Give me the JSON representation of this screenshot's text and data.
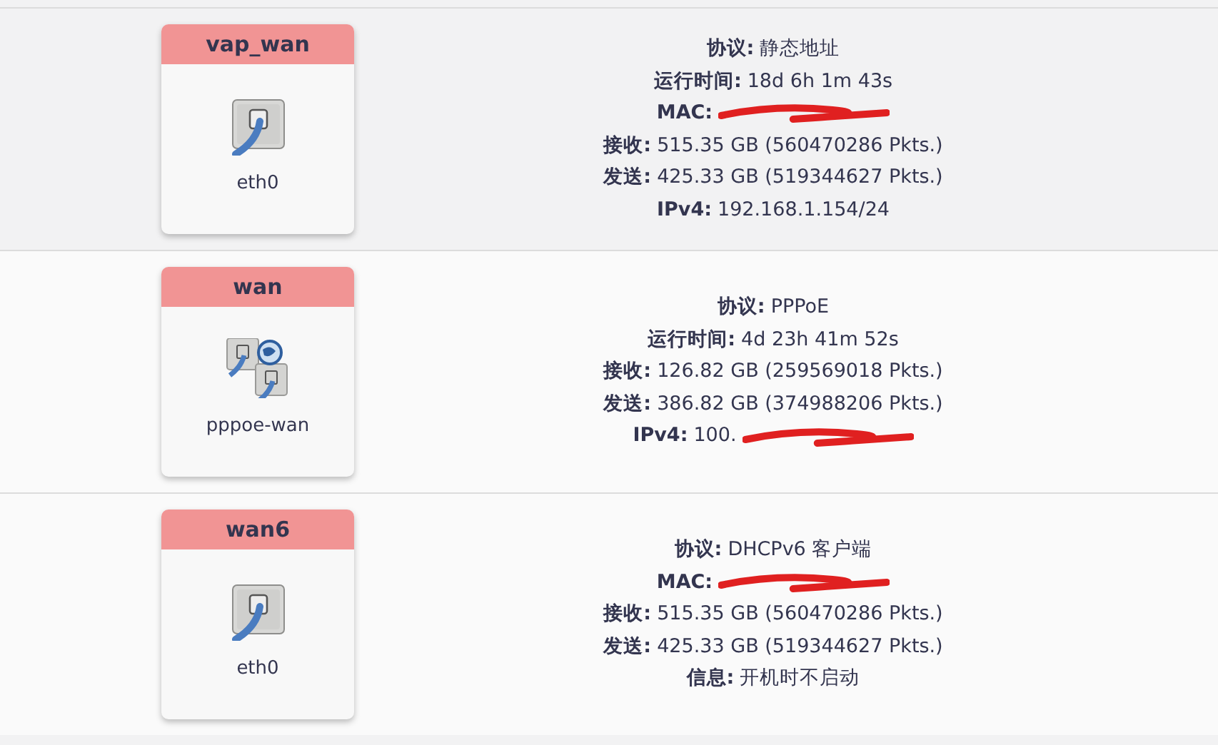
{
  "interfaces": [
    {
      "name": "vap_wan",
      "kind": "ethernet",
      "device": "eth0",
      "details": [
        {
          "label": "协议:",
          "value": "静态地址"
        },
        {
          "label": "运行时间:",
          "value": "18d 6h 1m 43s"
        },
        {
          "label": "MAC:",
          "redacted": true
        },
        {
          "label": "接收:",
          "value": "515.35 GB (560470286 Pkts.)"
        },
        {
          "label": "发送:",
          "value": "425.33 GB (519344627 Pkts.)"
        },
        {
          "label": "IPv4:",
          "value": "192.168.1.154/24"
        }
      ]
    },
    {
      "name": "wan",
      "kind": "pppoe",
      "device": "pppoe-wan",
      "details": [
        {
          "label": "协议:",
          "value": "PPPoE"
        },
        {
          "label": "运行时间:",
          "value": "4d 23h 41m 52s"
        },
        {
          "label": "接收:",
          "value": "126.82 GB (259569018 Pkts.)"
        },
        {
          "label": "发送:",
          "value": "386.82 GB (374988206 Pkts.)"
        },
        {
          "label": "IPv4:",
          "value": "100.",
          "redacted": true
        }
      ]
    },
    {
      "name": "wan6",
      "kind": "ethernet",
      "device": "eth0",
      "details": [
        {
          "label": "协议:",
          "value": "DHCPv6 客户端"
        },
        {
          "label": "MAC:",
          "redacted": true
        },
        {
          "label": "接收:",
          "value": "515.35 GB (560470286 Pkts.)"
        },
        {
          "label": "发送:",
          "value": "425.33 GB (519344627 Pkts.)"
        },
        {
          "label": "信息:",
          "value": "开机时不启动"
        }
      ]
    }
  ]
}
